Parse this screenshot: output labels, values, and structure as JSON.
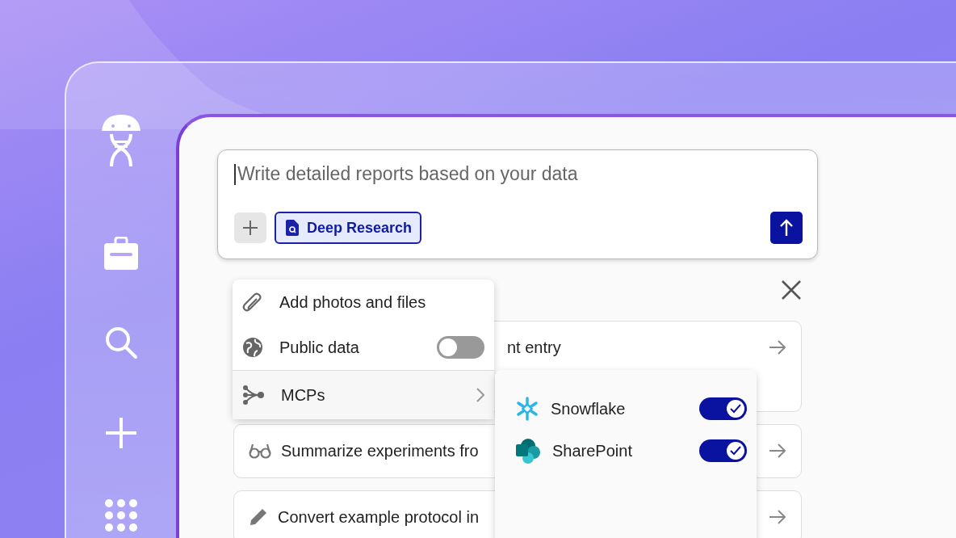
{
  "prompt": {
    "placeholder": "Write detailed reports based on your data",
    "mode_chip": "Deep Research"
  },
  "attach_menu": {
    "items": [
      {
        "kind": "action",
        "label": "Add photos and files"
      },
      {
        "kind": "toggle",
        "label": "Public data",
        "on": false
      },
      {
        "kind": "submenu",
        "label": "MCPs",
        "expanded": true
      }
    ]
  },
  "mcp_menu": {
    "items": [
      {
        "kind": "snowflake",
        "label": "Snowflake",
        "on": true
      },
      {
        "kind": "sharepoint",
        "label": "SharePoint",
        "on": true
      }
    ]
  },
  "suggestions": [
    {
      "kind": "covered",
      "text": "nt entry"
    },
    {
      "kind": "glasses",
      "text": "Summarize experiments fro"
    },
    {
      "kind": "pencil",
      "text": "Convert example protocol in"
    }
  ]
}
